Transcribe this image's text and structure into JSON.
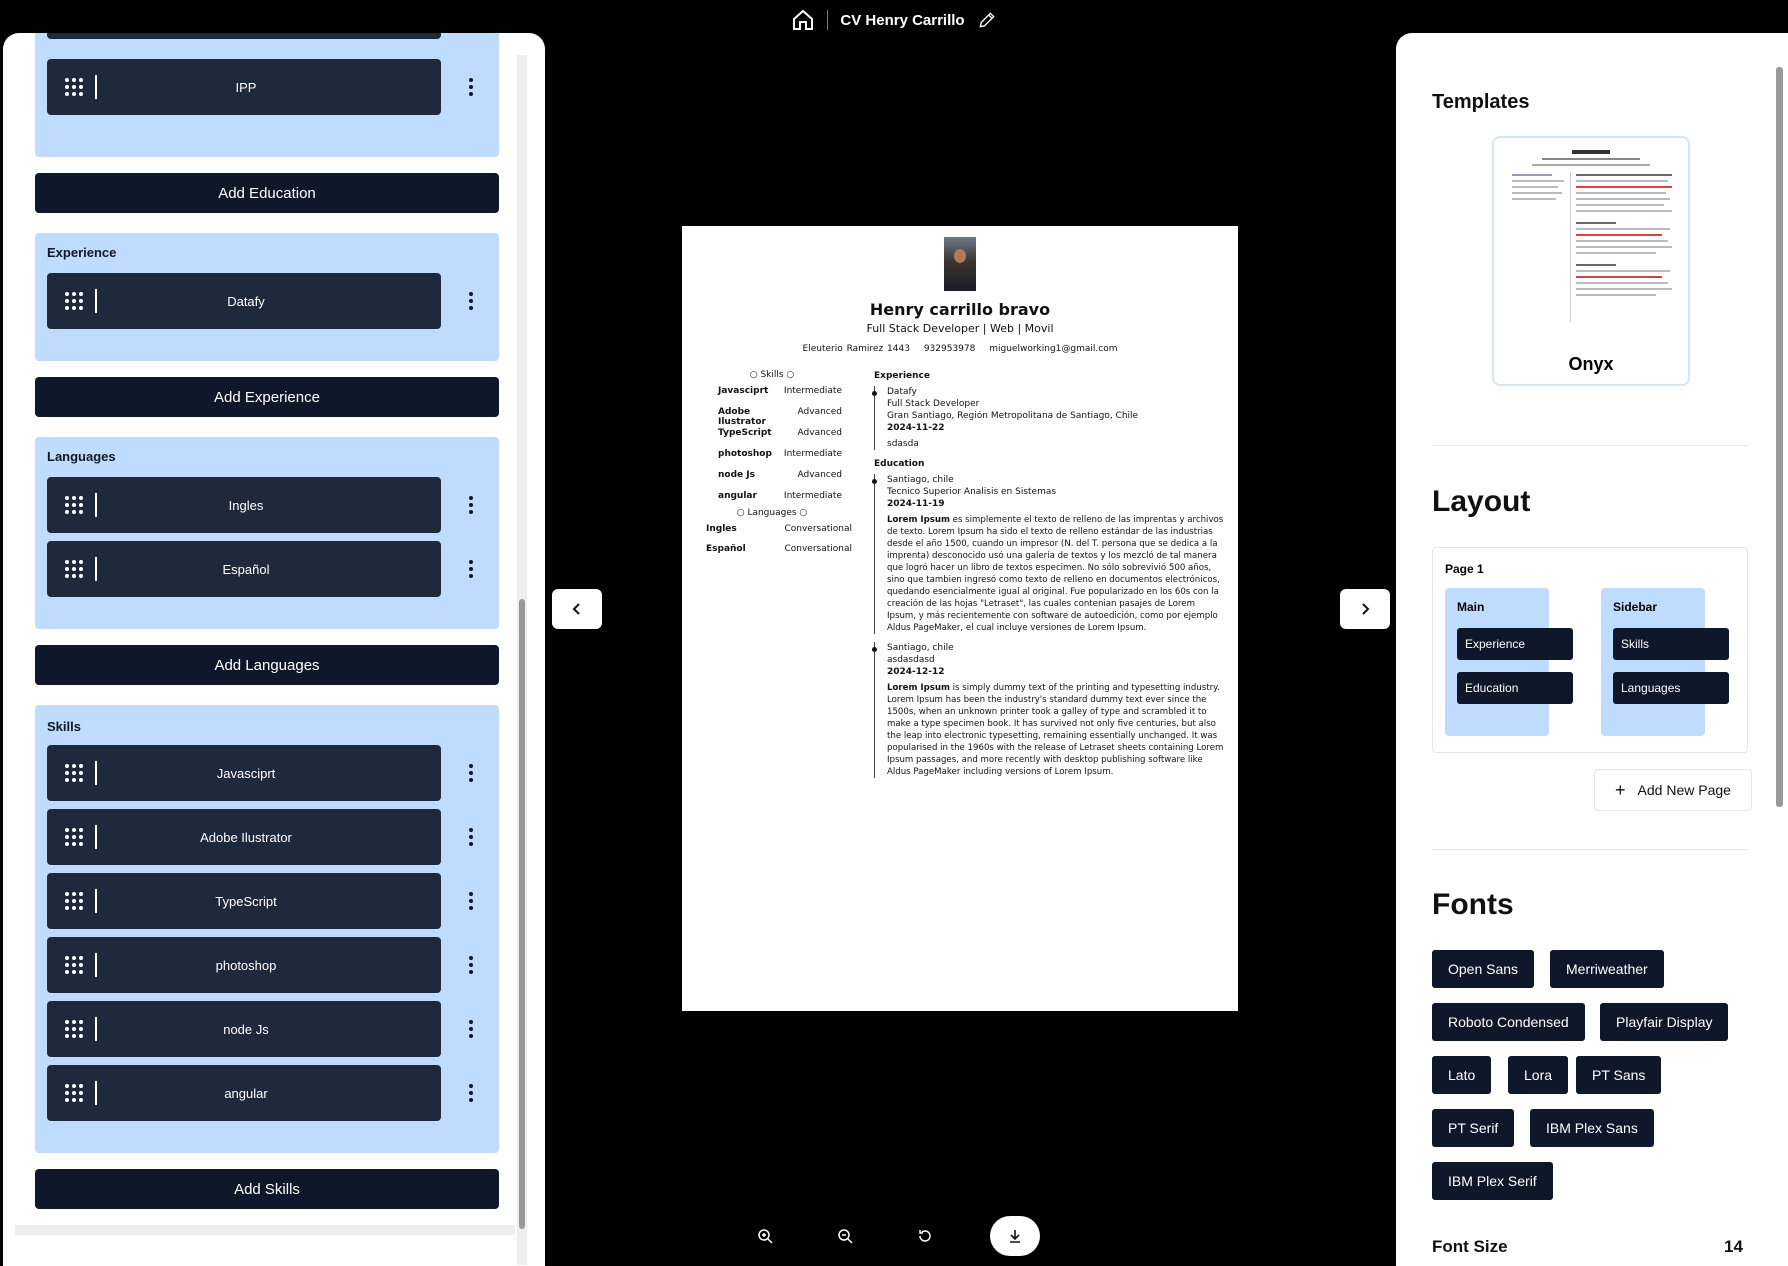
{
  "topbar": {
    "title": "CV Henry Carrillo"
  },
  "left": {
    "education_items": [
      "IPP"
    ],
    "add_education": "Add Education",
    "experience_label": "Experience",
    "experience_items": [
      "Datafy"
    ],
    "add_experience": "Add Experience",
    "languages_label": "Languages",
    "language_items": [
      "Ingles",
      "Español"
    ],
    "add_languages": "Add Languages",
    "skills_label": "Skills",
    "skill_items": [
      "Javasciprt",
      "Adobe Ilustrator",
      "TypeScript",
      "photoshop",
      "node Js",
      "angular"
    ],
    "add_skills": "Add Skills"
  },
  "cv": {
    "name": "Henry carrillo bravo",
    "title": "Full Stack Developer | Web | Movil",
    "address": "Eleuterio Ramirez 1443",
    "phone": "932953978",
    "email": "miguelworking1@gmail.com",
    "skills_heading": "Skills",
    "skills": [
      {
        "name": "Javasciprt",
        "level": "Intermediate"
      },
      {
        "name": "Adobe Ilustrator",
        "level": "Advanced"
      },
      {
        "name": "TypeScript",
        "level": "Advanced"
      },
      {
        "name": "photoshop",
        "level": "Intermediate"
      },
      {
        "name": "node Js",
        "level": "Advanced"
      },
      {
        "name": "angular",
        "level": "Intermediate"
      }
    ],
    "languages_heading": "Languages",
    "languages": [
      {
        "name": "Ingles",
        "level": "Conversational"
      },
      {
        "name": "Español",
        "level": "Conversational"
      }
    ],
    "experience_heading": "Experience",
    "experience": {
      "company": "Datafy",
      "role": "Full Stack Developer",
      "location": "Gran Santiago, Región Metropolitana de Santiago, Chile",
      "date": "2024-11-22",
      "desc": "sdasda"
    },
    "education_heading": "Education",
    "education": [
      {
        "place": "Santiago, chile",
        "degree": "Tecnico Superior Analisis en Sistemas",
        "date": "2024-11-19",
        "lead": "Lorem Ipsum",
        "text": " es simplemente el texto de relleno de las imprentas y archivos de texto. Lorem Ipsum ha sido el texto de relleno estándar de las industrias desde el año 1500, cuando un impresor (N. del T. persona que se dedica a la imprenta) desconocido usó una galería de textos y los mezcló de tal manera que logró hacer un libro de textos especimen. No sólo sobrevivió 500 años, sino que tambien ingresó como texto de relleno en documentos electrónicos, quedando esencialmente igual al original. Fue popularizado en los 60s con la creación de las hojas \"Letraset\", las cuales contenian pasajes de Lorem Ipsum, y más recientemente con software de autoedición, como por ejemplo Aldus PageMaker, el cual incluye versiones de Lorem Ipsum."
      },
      {
        "place": "Santiago, chile",
        "degree": "asdasdasd",
        "date": "2024-12-12",
        "lead": "Lorem Ipsum",
        "text": " is simply dummy text of the printing and typesetting industry. Lorem Ipsum has been the industry's standard dummy text ever since the 1500s, when an unknown printer took a galley of type and scrambled it to make a type specimen book. It has survived not only five centuries, but also the leap into electronic typesetting, remaining essentially unchanged. It was popularised in the 1960s with the release of Letraset sheets containing Lorem Ipsum passages, and more recently with desktop publishing software like Aldus PageMaker including versions of Lorem Ipsum."
      }
    ]
  },
  "right": {
    "templates_heading": "Templates",
    "template_name": "Onyx",
    "layout_heading": "Layout",
    "page_label": "Page 1",
    "main_label": "Main",
    "sidebar_label": "Sidebar",
    "main_items": [
      "Experience",
      "Education"
    ],
    "sidebar_items": [
      "Skills",
      "Languages"
    ],
    "add_page": "Add New Page",
    "fonts_heading": "Fonts",
    "fonts": [
      "Open Sans",
      "Merriweather",
      "Roboto Condensed",
      "Playfair Display",
      "Lato",
      "Lora",
      "PT Sans",
      "PT Serif",
      "IBM Plex Sans",
      "IBM Plex Serif"
    ],
    "font_size_label": "Font Size",
    "font_size_value": "14"
  }
}
